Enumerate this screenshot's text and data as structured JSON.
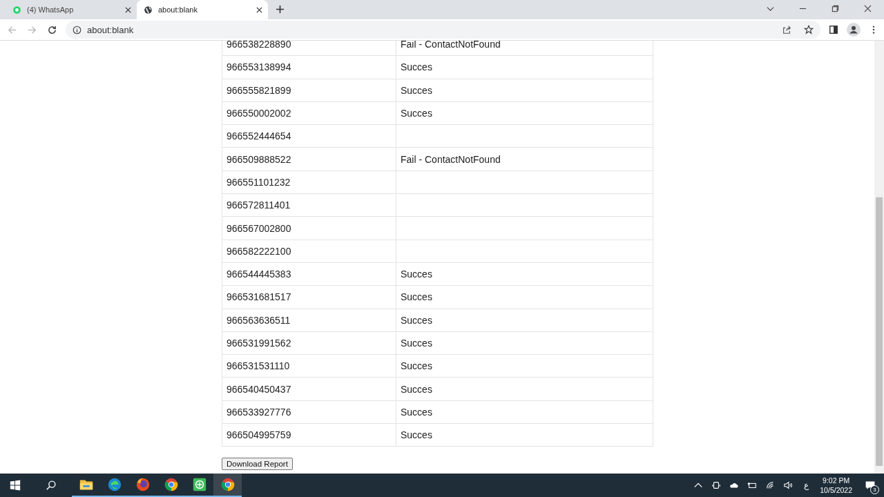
{
  "tabs": [
    {
      "label": "(4) WhatsApp",
      "kind": "chat",
      "selected": false
    },
    {
      "label": "about:blank",
      "kind": "web",
      "selected": true
    }
  ],
  "address_bar": {
    "url": "about:blank"
  },
  "table": {
    "rows": [
      {
        "number": "966538228890",
        "status": "Fail - ContactNotFound"
      },
      {
        "number": "966553138994",
        "status": "Succes"
      },
      {
        "number": "966555821899",
        "status": "Succes"
      },
      {
        "number": "966550002002",
        "status": "Succes"
      },
      {
        "number": "966552444654"
      },
      {
        "number": "966509888522",
        "status": "Fail - ContactNotFound"
      },
      {
        "number": "966551101232"
      },
      {
        "number": "966572811401"
      },
      {
        "number": "966567002800"
      },
      {
        "number": "966582222100"
      },
      {
        "number": "966544445383",
        "status": "Succes"
      },
      {
        "number": "966531681517",
        "status": "Succes"
      },
      {
        "number": "966563636511",
        "status": "Succes"
      },
      {
        "number": "966531991562",
        "status": "Succes"
      },
      {
        "number": "966531531110",
        "status": "Succes"
      },
      {
        "number": "966540450437",
        "status": "Succes"
      },
      {
        "number": "966533927776",
        "status": "Succes"
      },
      {
        "number": "966504995759",
        "status": "Succes"
      }
    ]
  },
  "download_button": "Download Report",
  "taskbar": {
    "apps": [
      {
        "kind": "explorer",
        "selected": false
      },
      {
        "kind": "edge",
        "selected": false
      },
      {
        "kind": "firefox",
        "selected": false
      },
      {
        "kind": "chrome",
        "selected": false
      },
      {
        "kind": "tool",
        "selected": false
      },
      {
        "kind": "chrome",
        "selected": true
      }
    ],
    "language": "ع",
    "time": "9:02 PM",
    "date": "10/5/2022",
    "notifications": "3"
  }
}
